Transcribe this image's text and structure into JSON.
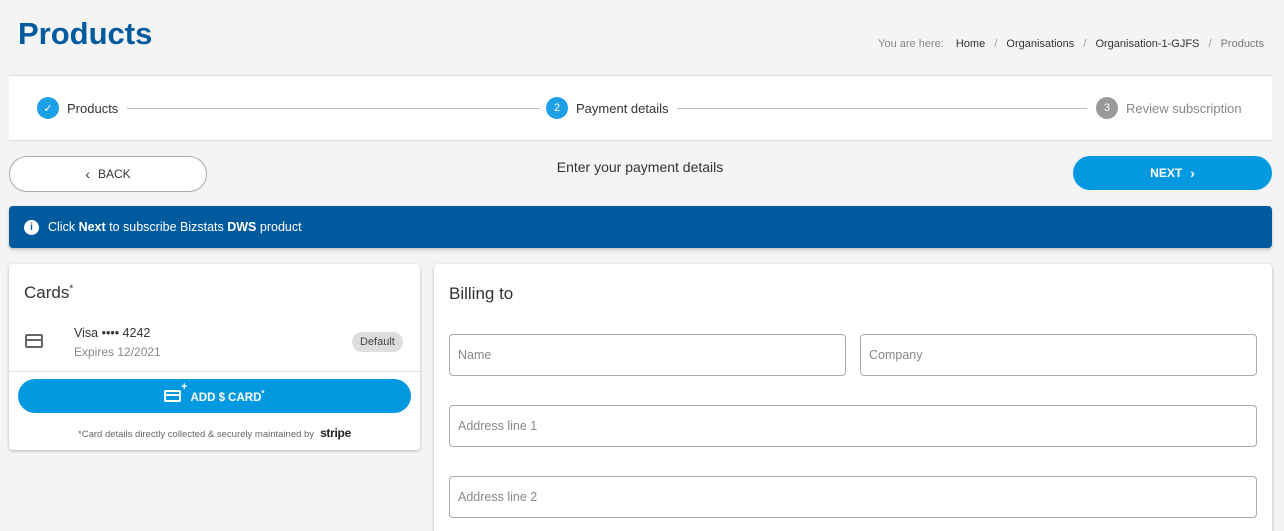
{
  "page": {
    "title": "Products"
  },
  "breadcrumb": {
    "prefix": "You are here:",
    "items": [
      "Home",
      "Organisations",
      "Organisation-1-GJFS",
      "Products"
    ],
    "separator": "/"
  },
  "stepper": {
    "steps": [
      {
        "number": "✓",
        "label": "Products",
        "state": "done"
      },
      {
        "number": "2",
        "label": "Payment details",
        "state": "active"
      },
      {
        "number": "3",
        "label": "Review subscription",
        "state": "pending"
      }
    ]
  },
  "nav": {
    "back_label": "BACK",
    "message": "Enter your payment details",
    "next_label": "NEXT"
  },
  "banner": {
    "pre": "Click ",
    "bold1": "Next",
    "mid": " to subscribe Bizstats ",
    "bold2": "DWS",
    "post": " product"
  },
  "cards": {
    "title": "Cards",
    "required_mark": "*",
    "items": [
      {
        "brand": "Visa •••• 4242",
        "expires": "Expires 12/2021",
        "badge": "Default"
      }
    ],
    "add_label": "ADD $ CARD",
    "add_mark": "*",
    "note": "*Card details directly collected & securely maintained by",
    "provider": "stripe"
  },
  "billing": {
    "title": "Billing to",
    "fields": {
      "name": {
        "placeholder": "Name",
        "value": ""
      },
      "company": {
        "placeholder": "Company",
        "value": ""
      },
      "address1": {
        "placeholder": "Address line 1",
        "value": ""
      },
      "address2": {
        "placeholder": "Address line 2",
        "value": ""
      }
    }
  },
  "colors": {
    "brand_dark": "#005a9e",
    "accent": "#0399e0",
    "pending": "#999999"
  }
}
